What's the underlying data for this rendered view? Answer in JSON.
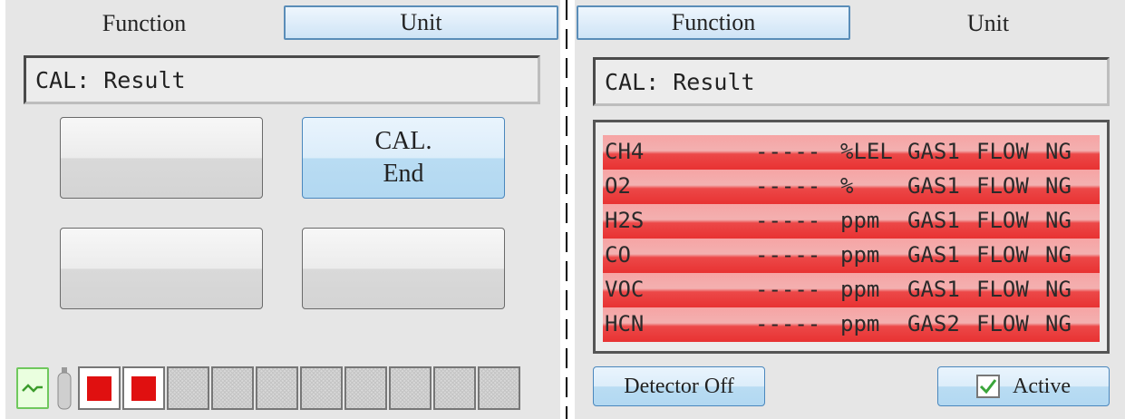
{
  "left": {
    "tabs": {
      "function": "Function",
      "unit": "Unit",
      "active": "function"
    },
    "title": "CAL: Result",
    "buttons": [
      {
        "label": ""
      },
      {
        "line1": "CAL.",
        "line2": "End"
      },
      {
        "label": ""
      },
      {
        "label": ""
      }
    ],
    "status_bar": {
      "sd_icon": "sd-card-icon",
      "bottle_icon": "gas-bottle-icon",
      "slots": [
        "on",
        "on",
        "off",
        "off",
        "off",
        "off",
        "off",
        "off",
        "off",
        "off"
      ]
    }
  },
  "right": {
    "tabs": {
      "function": "Function",
      "unit": "Unit",
      "active": "unit"
    },
    "title": "CAL: Result",
    "results": [
      {
        "gas": "CH4",
        "value": "-----",
        "unit": "%LEL",
        "channel": "GAS1",
        "flow": "FLOW",
        "status": "NG"
      },
      {
        "gas": "O2",
        "value": "-----",
        "unit": "%",
        "channel": "GAS1",
        "flow": "FLOW",
        "status": "NG"
      },
      {
        "gas": "H2S",
        "value": "-----",
        "unit": "ppm",
        "channel": "GAS1",
        "flow": "FLOW",
        "status": "NG"
      },
      {
        "gas": "CO",
        "value": "-----",
        "unit": "ppm",
        "channel": "GAS1",
        "flow": "FLOW",
        "status": "NG"
      },
      {
        "gas": "VOC",
        "value": "-----",
        "unit": "ppm",
        "channel": "GAS1",
        "flow": "FLOW",
        "status": "NG"
      },
      {
        "gas": "HCN",
        "value": "-----",
        "unit": "ppm",
        "channel": "GAS2",
        "flow": "FLOW",
        "status": "NG"
      }
    ],
    "detector_off_label": "Detector Off",
    "active_label": "Active",
    "active_checked": true
  },
  "colors": {
    "row_ng": "#e83232",
    "button_blue": "#b9dcf3",
    "tab_border": "#5a8db8",
    "check_green": "#3aa53a"
  }
}
